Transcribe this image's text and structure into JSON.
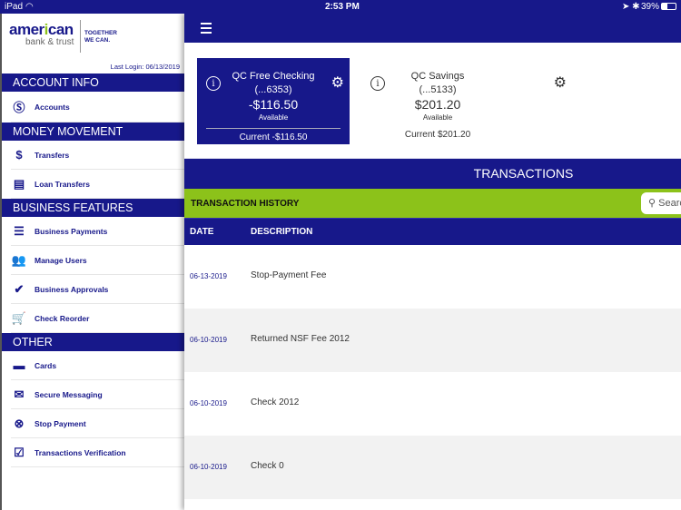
{
  "status": {
    "device": "iPad",
    "time": "2:53 PM",
    "battery": "39%"
  },
  "logo": {
    "name": "american",
    "sub": "bank & trust",
    "tag1": "TOGETHER",
    "tag2": "WE CAN."
  },
  "last_login": "Last Login:  06/13/2019",
  "sidebar": {
    "sections": [
      {
        "title": "ACCOUNT INFO",
        "items": [
          "Accounts"
        ]
      },
      {
        "title": "MONEY MOVEMENT",
        "items": [
          "Transfers",
          "Loan Transfers"
        ]
      },
      {
        "title": "BUSINESS FEATURES",
        "items": [
          "Business Payments",
          "Manage Users",
          "Business Approvals",
          "Check Reorder"
        ]
      },
      {
        "title": "OTHER",
        "items": [
          "Cards",
          "Secure Messaging",
          "Stop Payment",
          "Transactions Verification"
        ]
      }
    ]
  },
  "accounts": [
    {
      "name": "QC Free Checking",
      "number": "(...6353)",
      "balance": "-$116.50",
      "available": "Available",
      "current": "Current -$116.50"
    },
    {
      "name": "QC Savings",
      "number": "(...5133)",
      "balance": "$201.20",
      "available": "Available",
      "current": "Current $201.20"
    }
  ],
  "transactions": {
    "title": "TRANSACTIONS",
    "history": "TRANSACTION HISTORY",
    "search_placeholder": "Search",
    "columns": [
      "DATE",
      "DESCRIPTION"
    ],
    "rows": [
      {
        "date": "06-13-2019",
        "desc": "Stop-Payment Fee"
      },
      {
        "date": "06-10-2019",
        "desc": "Returned NSF Fee 2012"
      },
      {
        "date": "06-10-2019",
        "desc": "Check 2012"
      },
      {
        "date": "06-10-2019",
        "desc": "Check 0"
      }
    ]
  },
  "colors": {
    "navy": "#17188a",
    "green": "#8cc21a"
  }
}
